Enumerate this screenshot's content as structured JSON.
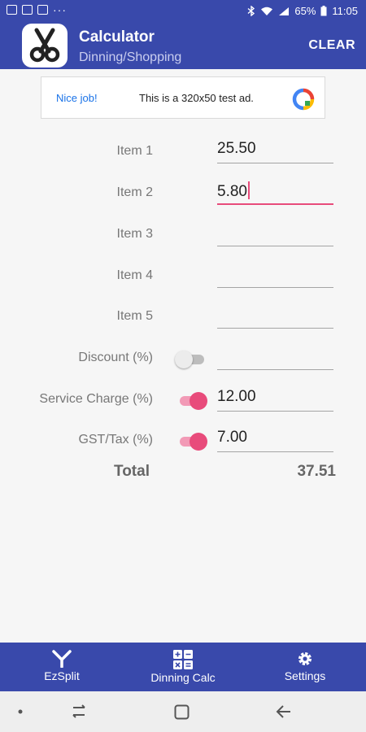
{
  "status_bar": {
    "battery": "65%",
    "time": "11:05",
    "dots": "···"
  },
  "app_bar": {
    "title": "Calculator",
    "subtitle": "Dinning/Shopping",
    "clear_label": "CLEAR"
  },
  "ad": {
    "left_text": "Nice job!",
    "text": "This is a 320x50 test ad."
  },
  "items": [
    {
      "label": "Item 1",
      "value": "25.50"
    },
    {
      "label": "Item 2",
      "value": "5.80"
    },
    {
      "label": "Item 3",
      "value": ""
    },
    {
      "label": "Item 4",
      "value": ""
    },
    {
      "label": "Item 5",
      "value": ""
    }
  ],
  "discount": {
    "label": "Discount (%)",
    "value": "",
    "enabled": false
  },
  "service_charge": {
    "label": "Service Charge (%)",
    "value": "12.00",
    "enabled": true
  },
  "gst": {
    "label": "GST/Tax (%)",
    "value": "7.00",
    "enabled": true
  },
  "total": {
    "label": "Total",
    "value": "37.51"
  },
  "bottom_nav": [
    {
      "label": "EzSplit",
      "icon": "split-icon"
    },
    {
      "label": "Dinning Calc",
      "icon": "calculator-icon"
    },
    {
      "label": "Settings",
      "icon": "gear-icon"
    }
  ],
  "colors": {
    "primary": "#3949ab",
    "accent": "#e84b7b",
    "background": "#f6f6f6"
  }
}
